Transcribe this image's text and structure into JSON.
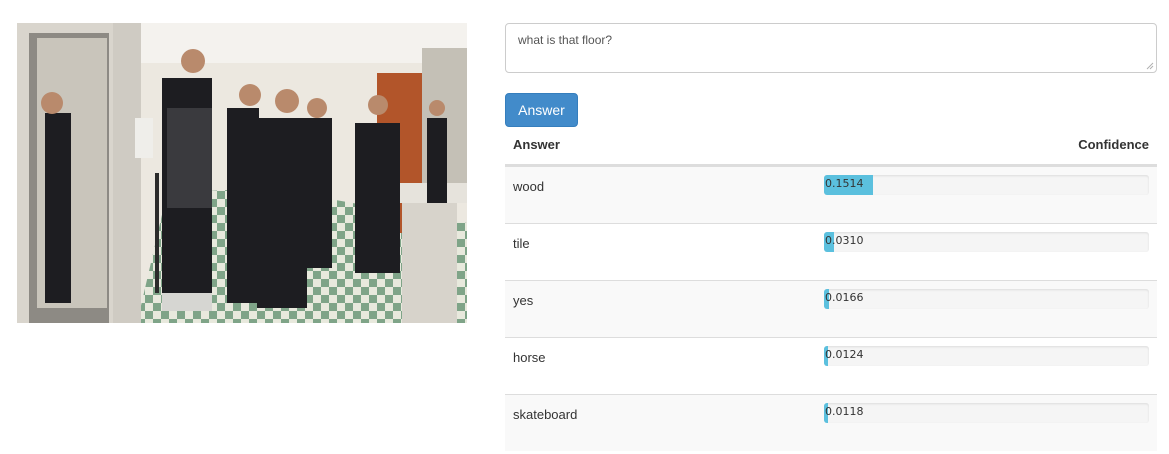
{
  "question": {
    "value": "what is that floor?"
  },
  "answer_button": {
    "label": "Answer"
  },
  "table": {
    "headers": {
      "answer": "Answer",
      "confidence": "Confidence"
    },
    "rows": [
      {
        "answer": "wood",
        "confidence": "0.1514",
        "confidence_value": 0.1514
      },
      {
        "answer": "tile",
        "confidence": "0.0310",
        "confidence_value": 0.031
      },
      {
        "answer": "yes",
        "confidence": "0.0166",
        "confidence_value": 0.0166
      },
      {
        "answer": "horse",
        "confidence": "0.0124",
        "confidence_value": 0.0124
      },
      {
        "answer": "skateboard",
        "confidence": "0.0118",
        "confidence_value": 0.0118
      }
    ]
  },
  "colors": {
    "button": "#428bca",
    "bar_fill": "#5bc0de",
    "bar_track": "#f5f5f5"
  }
}
